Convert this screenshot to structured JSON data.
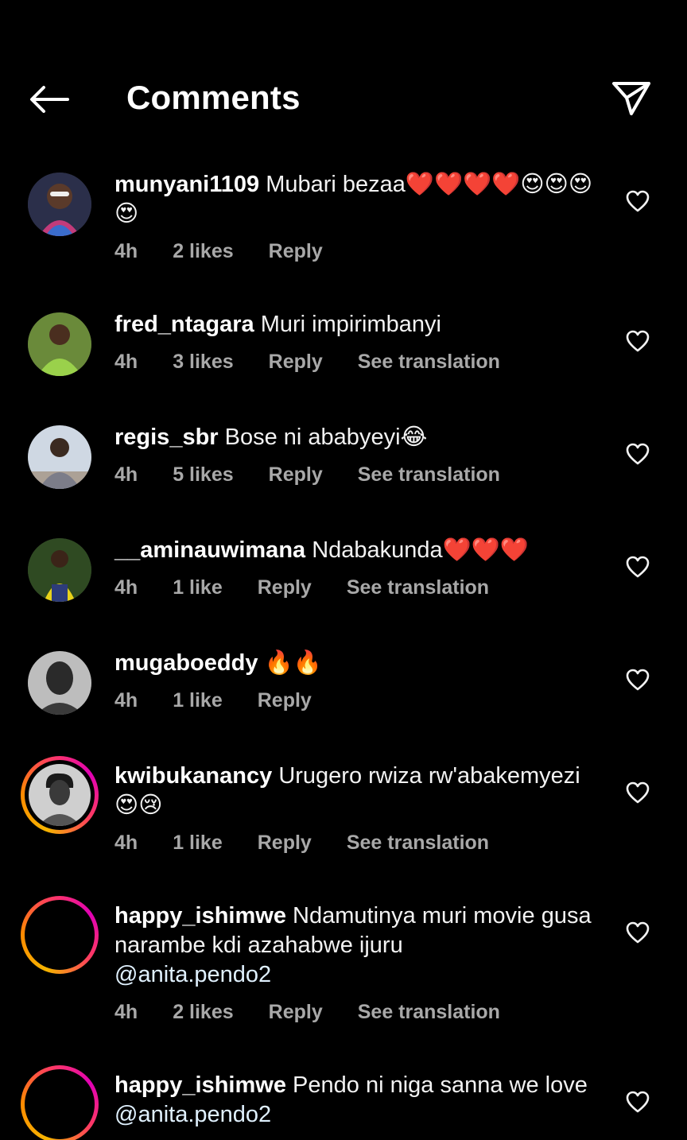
{
  "header": {
    "title": "Comments"
  },
  "comments": [
    {
      "username": "munyani1109",
      "text": "Mubari bezaa❤️❤️❤️❤️😍😍😍😍",
      "time": "4h",
      "likes": "2 likes",
      "reply": "Reply",
      "translation": ""
    },
    {
      "username": "fred_ntagara",
      "text": "Muri impirimbanyi",
      "time": "4h",
      "likes": "3 likes",
      "reply": "Reply",
      "translation": "See translation"
    },
    {
      "username": "regis_sbr",
      "text": "Bose ni ababyeyi😂",
      "time": "4h",
      "likes": "5 likes",
      "reply": "Reply",
      "translation": "See translation"
    },
    {
      "username": "__aminauwimana",
      "text": "Ndabakunda❤️❤️❤️",
      "time": "4h",
      "likes": "1 like",
      "reply": "Reply",
      "translation": "See translation"
    },
    {
      "username": "mugaboeddy",
      "text": "🔥🔥",
      "time": "4h",
      "likes": "1 like",
      "reply": "Reply",
      "translation": ""
    },
    {
      "username": "kwibukanancy",
      "text": "Urugero rwiza rw'abakemyezi 😍😢",
      "time": "4h",
      "likes": "1 like",
      "reply": "Reply",
      "translation": "See translation"
    },
    {
      "username": "happy_ishimwe",
      "text": "Ndamutinya muri movie gusa narambe kdi azahabwe ijuru",
      "mention": "@anita.pendo2",
      "time": "4h",
      "likes": "2 likes",
      "reply": "Reply",
      "translation": "See translation"
    },
    {
      "username": "happy_ishimwe",
      "text": "Pendo ni niga sanna we love",
      "mention": "@anita.pendo2"
    }
  ]
}
